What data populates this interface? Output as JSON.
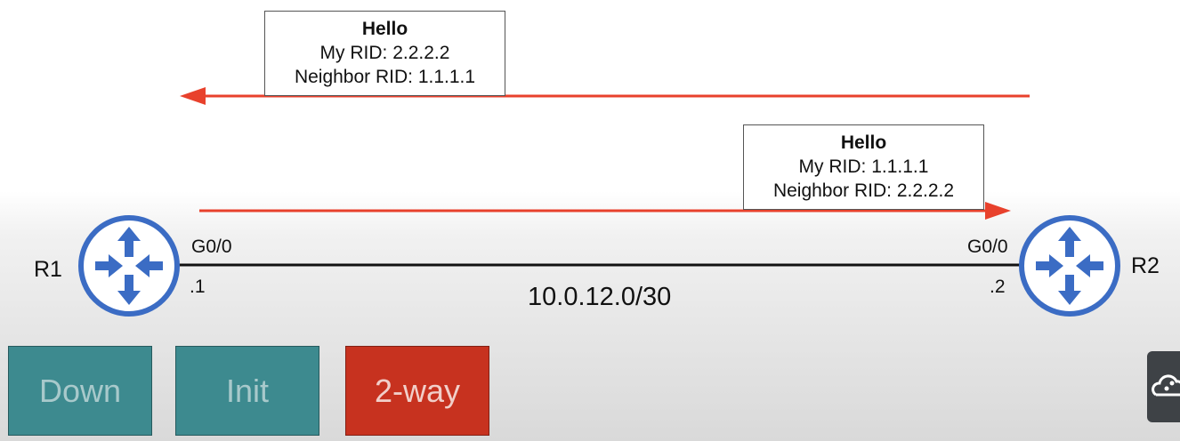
{
  "hello_from_r2": {
    "title": "Hello",
    "my_rid": "My RID: 2.2.2.2",
    "neighbor_rid": "Neighbor RID: 1.1.1.1"
  },
  "hello_from_r1": {
    "title": "Hello",
    "my_rid": "My RID: 1.1.1.1",
    "neighbor_rid": "Neighbor RID: 2.2.2.2"
  },
  "routers": {
    "r1": {
      "name": "R1",
      "interface": "G0/0",
      "ip_suffix": ".1"
    },
    "r2": {
      "name": "R2",
      "interface": "G0/0",
      "ip_suffix": ".2"
    }
  },
  "link": {
    "subnet": "10.0.12.0/30"
  },
  "states": {
    "down": "Down",
    "init": "Init",
    "two_way": "2-way"
  },
  "colors": {
    "arrow": "#e8412c",
    "router": "#3b6cc4",
    "state_inactive": "#3d8a8f",
    "state_active": "#c7321f"
  },
  "icons": {
    "router": "router-icon",
    "side_tool": "cloud-icon"
  }
}
